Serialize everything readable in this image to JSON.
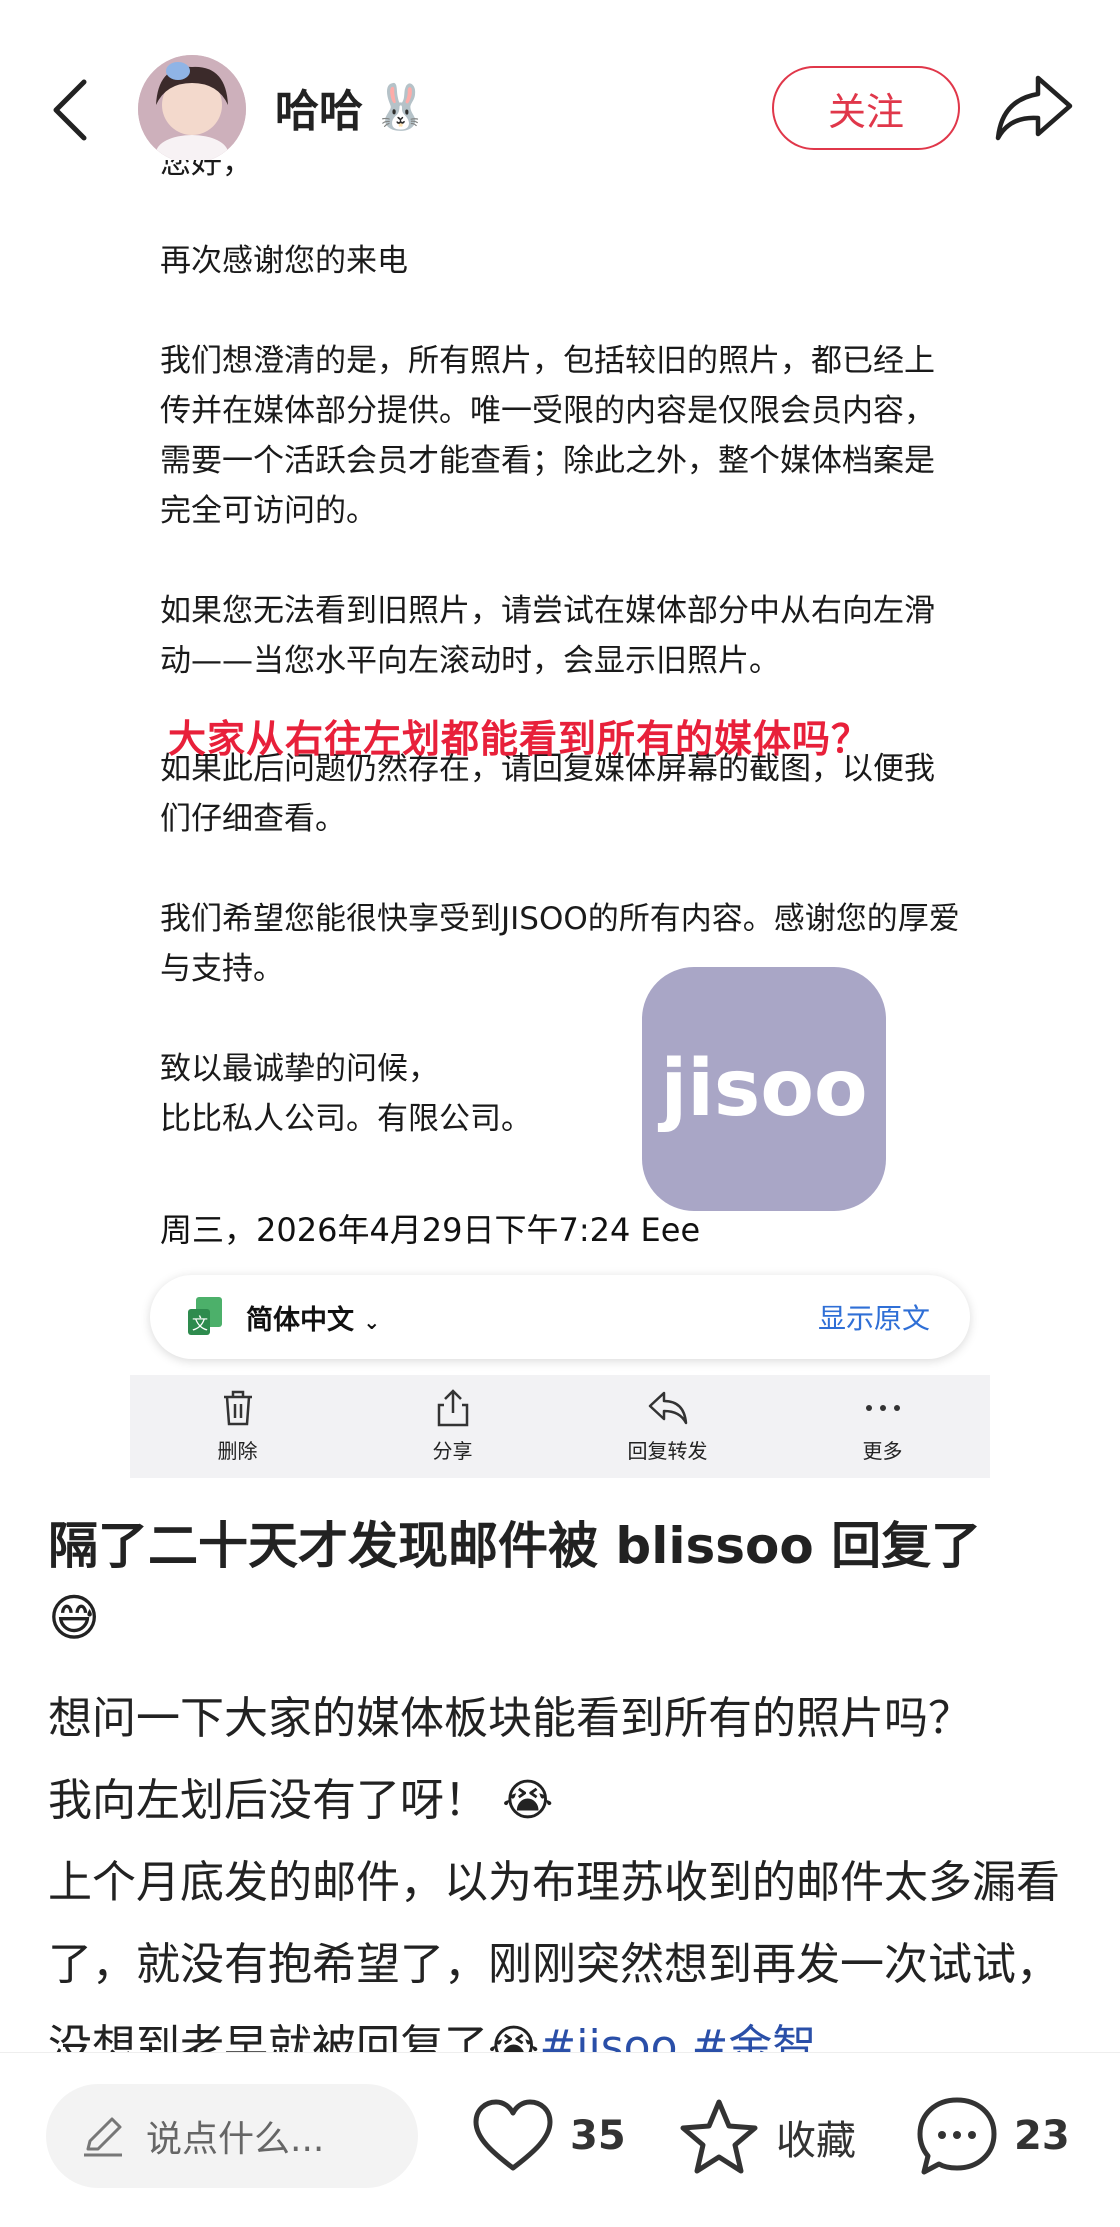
{
  "header": {
    "username": "哈哈",
    "username_emoji": "🐰",
    "follow_label": "关注"
  },
  "email": {
    "cut_line": "您好，",
    "para1": "再次感谢您的来电",
    "para2": "我们想澄清的是，所有照片，包括较旧的照片，都已经上传并在媒体部分提供。唯一受限的内容是仅限会员内容，需要一个活跃会员才能查看；除此之外，整个媒体档案是完全可访问的。",
    "para3": "如果您无法看到旧照片，请尝试在媒体部分中从右向左滑动——当您水平向左滚动时，会显示旧照片。",
    "red_overlay": "大家从右往左划都能看到所有的媒体吗？",
    "para4": "如果此后问题仍然存在，请回复媒体屏幕的截图，以便我们仔细查看。",
    "para5": "我们希望您能很快享受到JISOO的所有内容。感谢您的厚爱与支持。",
    "closing1": "致以最诚挚的问候，",
    "closing2": "比比私人公司。有限公司。",
    "logo_text": "jisoo",
    "date": "周三，2026年4月29日下午7:24 Eee",
    "translate_lang": "简体中文",
    "show_original": "显示原文",
    "toolbar": [
      "删除",
      "分享",
      "回复转发",
      "更多"
    ]
  },
  "post": {
    "title": "隔了二十天才发现邮件被 blissoo 回复了",
    "title_emoji": "😅",
    "line1": "想问一下大家的媒体板块能看到所有的照片吗？",
    "line2": "我向左划后没有了呀！",
    "line2_emoji": "😭",
    "line3": "上个月底发的邮件，以为布理苏收到的邮件太多漏看了，就没有抱希望了，刚刚突然想到再发一次试试，没想到老早就被回复了",
    "line3_emoji": "😭",
    "tag1": "#jisoo",
    "tag2": "#金智"
  },
  "bottom_bar": {
    "comment_placeholder": "说点什么...",
    "likes": "35",
    "collect_label": "收藏",
    "comments": "23"
  }
}
